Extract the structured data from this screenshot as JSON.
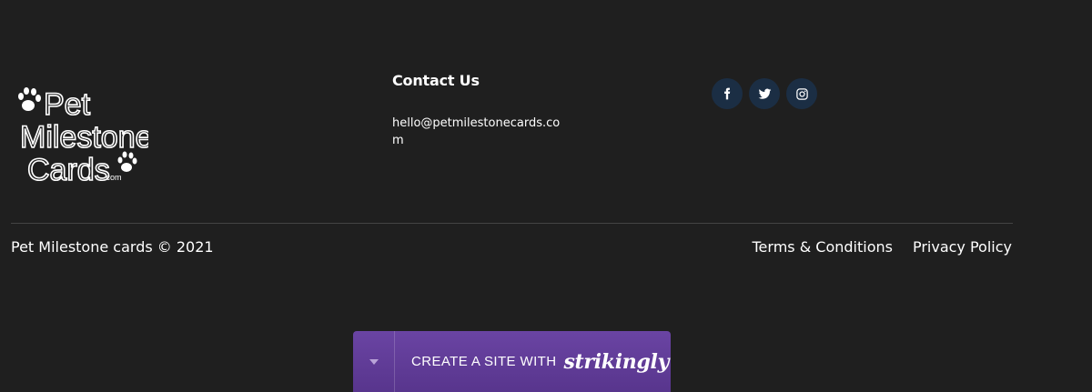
{
  "logo": {
    "line1": "Pet",
    "line2": "Milestone",
    "line3": "Cards",
    "suffix": ".com"
  },
  "contact": {
    "title": "Contact Us",
    "email": "hello@petmilestonecards.com"
  },
  "social": {
    "icons": [
      "facebook-icon",
      "twitter-icon",
      "instagram-icon"
    ],
    "button_bg": "#1b2e44"
  },
  "footer": {
    "copyright": "Pet Milestone cards © 2021",
    "links": {
      "terms": "Terms & Conditions",
      "privacy": "Privacy Policy"
    }
  },
  "strikingly": {
    "cta": "CREATE A SITE WITH",
    "brand": "strikingly",
    "accent": "#62409a"
  },
  "colors": {
    "background": "#1f1f1f",
    "text": "#ffffff",
    "divider": "#444444"
  }
}
